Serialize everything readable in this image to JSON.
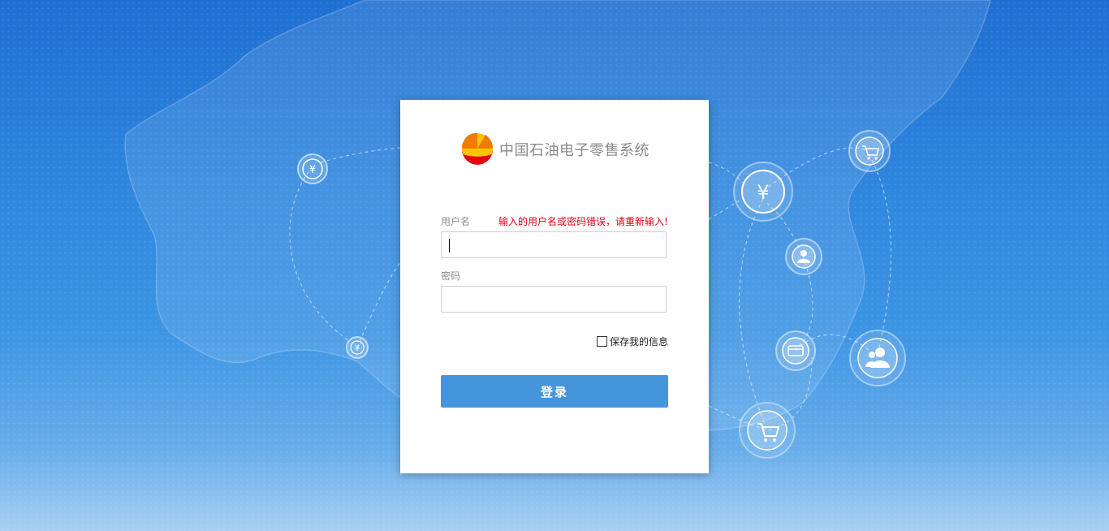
{
  "app": {
    "title": "中国石油电子零售系统",
    "logo_icon": "cnpc-petal-logo-icon"
  },
  "form": {
    "username_label": "用户名",
    "username_value": "",
    "error_message": "输入的用户名或密码错误，请重新输入!",
    "password_label": "密码",
    "password_value": "",
    "remember_label": "保存我的信息",
    "remember_checked": false,
    "submit_label": "登录"
  },
  "background_icons": [
    "yen-icon",
    "yen-icon",
    "yen-icon",
    "user-icon",
    "card-icon",
    "users-icon",
    "cart-icon",
    "cart-icon"
  ],
  "colors": {
    "background_top": "#1f6fd2",
    "background_bottom": "#a9d0f3",
    "button": "#4595dc",
    "error": "#e60012",
    "logo_red": "#e60012",
    "logo_yellow": "#f9c400"
  }
}
